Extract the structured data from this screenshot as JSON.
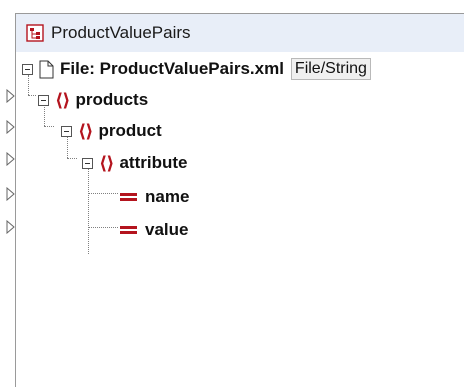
{
  "component": {
    "title": "ProductValuePairs",
    "file_label": "File: ProductValuePairs.xml",
    "file_button": "File/String"
  },
  "tree": {
    "products": "products",
    "product": "product",
    "attribute": "attribute",
    "name": "name",
    "value": "value"
  },
  "colors": {
    "accent": "#b4141e",
    "titlebar": "#e8eef8"
  }
}
